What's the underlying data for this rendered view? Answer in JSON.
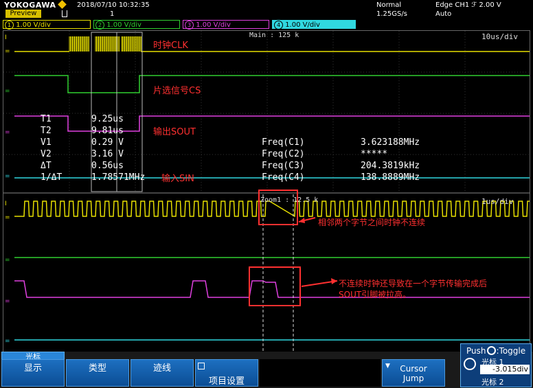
{
  "header": {
    "brand": "YOKOGAWA",
    "mode_label": "Preview",
    "trigger_icon": "trigger-mode-icon",
    "count": "1",
    "datetime": "2018/07/10 10:32:35",
    "acq_mode": "Normal",
    "sample_rate": "1.25GS/s",
    "trigger": "Edge CH1 ℱ 2.00 V",
    "trigger_mode": "Auto"
  },
  "channels": [
    {
      "num": "1",
      "scale": "1.00 V/div",
      "color": "#e8e000"
    },
    {
      "num": "2",
      "scale": "1.00 V/div",
      "color": "#30d030"
    },
    {
      "num": "3",
      "scale": "1.00 V/div",
      "color": "#e040e0"
    },
    {
      "num": "4",
      "scale": "1.00 V/div",
      "color": "#30d8e0"
    }
  ],
  "main": {
    "main_label": "Main : 125 k",
    "timebase": "10us/div",
    "zoom_label": "Zoom1 : 12.5 k",
    "zoom_timebase": "1us/div"
  },
  "signals": {
    "clk": "时钟CLK",
    "cs": "片选信号CS",
    "sout": "输出SOUT",
    "sin": "输入SIN"
  },
  "measurements": [
    {
      "name": "T1",
      "value": "9.25us"
    },
    {
      "name": "T2",
      "value": "9.81us"
    },
    {
      "name": "V1",
      "value": "0.29 V"
    },
    {
      "name": "V2",
      "value": "3.16 V"
    },
    {
      "name": "ΔT",
      "value": "0.56us"
    },
    {
      "name": "1/ΔT",
      "value": "1.78571MHz"
    }
  ],
  "frequencies": [
    {
      "name": "Freq(C1)",
      "value": "3.623188MHz"
    },
    {
      "name": "Freq(C2)",
      "value": "*****"
    },
    {
      "name": "Freq(C3)",
      "value": "204.3819kHz"
    },
    {
      "name": "Freq(C4)",
      "value": "138.8889MHz"
    }
  ],
  "annotations": {
    "a1": "相邻两个字节之间时钟不连续",
    "a2_line1": "不连续时钟还导致在一个字节传输完成后",
    "a2_line2": "SOUT引脚被拉高。"
  },
  "softkeys": {
    "tab": "光标",
    "display": "显示",
    "type": "类型",
    "trace": "迹线",
    "item_settings": "项目设置",
    "cursor_jump_1": "Cursor",
    "cursor_jump_2": "Jump",
    "push_label": "Push",
    "push_action": ":Toggle",
    "cursor1_label": "光标 1",
    "cursor1_value": "-3.015div",
    "cursor2_label": "光标 2"
  },
  "colors": {
    "ch1": "#e8e000",
    "ch2": "#30d030",
    "ch3": "#e040e0",
    "ch4": "#30d8e0",
    "annotation": "#ff3030",
    "softkey": "#1d6fc0"
  }
}
